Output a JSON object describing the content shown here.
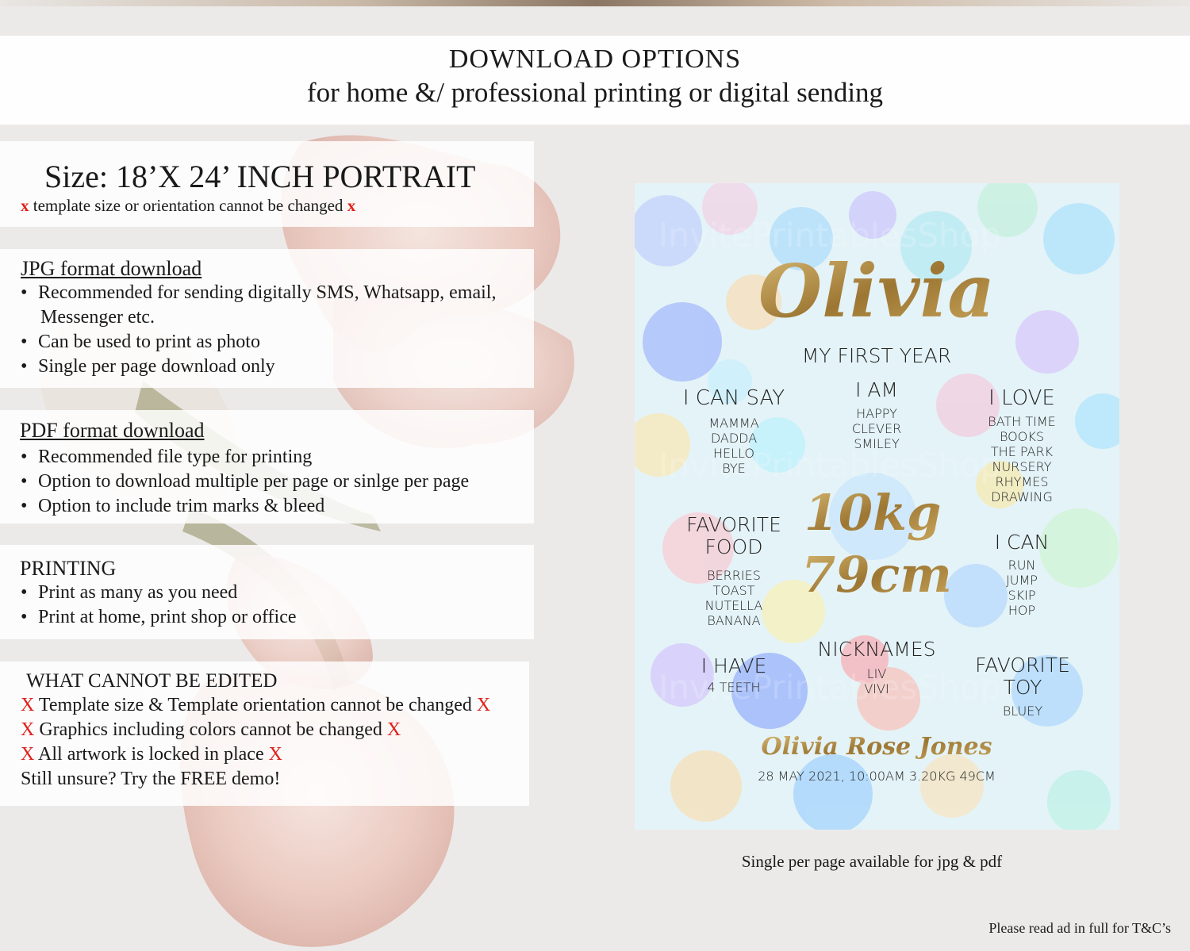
{
  "header": {
    "title": "DOWNLOAD OPTIONS",
    "subtitle": "for home &/ professional printing or digital sending"
  },
  "size_panel": {
    "heading": "Size: 18’X 24’ INCH PORTRAIT",
    "note_x": "x",
    "note": "template size or orientation cannot be changed"
  },
  "jpg_panel": {
    "heading": "JPG format download",
    "items": [
      "Recommended for sending digitally SMS, Whatsapp, email,",
      "Messenger etc.",
      "Can be used to print as photo",
      "Single per page download only"
    ]
  },
  "pdf_panel": {
    "heading": "PDF format download",
    "items": [
      "Recommended file type for printing",
      "Option to download multiple per page or sinlge per page",
      "Option to include trim marks & bleed"
    ]
  },
  "printing_panel": {
    "heading": "PRINTING",
    "items": [
      "Print as many as you need",
      "Print at home, print shop or office"
    ]
  },
  "cannot_panel": {
    "heading": "WHAT CANNOT BE EDITED",
    "x": "X",
    "items": [
      "Template size & Template orientation cannot be changed",
      "Graphics including colors cannot be changed",
      "All artwork is locked in place"
    ],
    "demo": "Still unsure? Try the FREE demo!"
  },
  "poster": {
    "name": "Olivia",
    "subtitle": "MY FIRST YEAR",
    "watermark": "InvitePrintablesShop",
    "can_say": {
      "title": "I CAN SAY",
      "items": [
        "MAMMA",
        "DADDA",
        "HELLO",
        "BYE"
      ]
    },
    "i_am": {
      "title": "I AM",
      "items": [
        "HAPPY",
        "CLEVER",
        "SMILEY"
      ]
    },
    "i_love": {
      "title": "I LOVE",
      "items": [
        "BATH TIME",
        "BOOKS",
        "THE PARK",
        "NURSERY",
        "RHYMES",
        "DRAWING"
      ]
    },
    "favorite_food": {
      "title1": "FAVORITE",
      "title2": "FOOD",
      "items": [
        "BERRIES",
        "TOAST",
        "NUTELLA",
        "BANANA"
      ]
    },
    "weight": "10kg",
    "height": "79cm",
    "i_can": {
      "title": "I CAN",
      "items": [
        "RUN",
        "JUMP",
        "SKIP",
        "HOP"
      ]
    },
    "i_have": {
      "title": "I HAVE",
      "items": [
        "4 TEETH"
      ]
    },
    "nicknames": {
      "title": "NICKNAMES",
      "items": [
        "LIV",
        "VIVI"
      ]
    },
    "favorite_toy": {
      "title1": "FAVORITE",
      "title2": "TOY",
      "items": [
        "BLUEY"
      ]
    },
    "full_name": "Olivia Rose Jones",
    "birth_details": "28 MAY 2021, 10:00AM 3.20KG 49CM"
  },
  "caption": "Single per page available for jpg & pdf",
  "footer": "Please read ad in full for T&C’s",
  "colors": {
    "red_x": "#e0201a",
    "gold": "#b08a3c"
  }
}
